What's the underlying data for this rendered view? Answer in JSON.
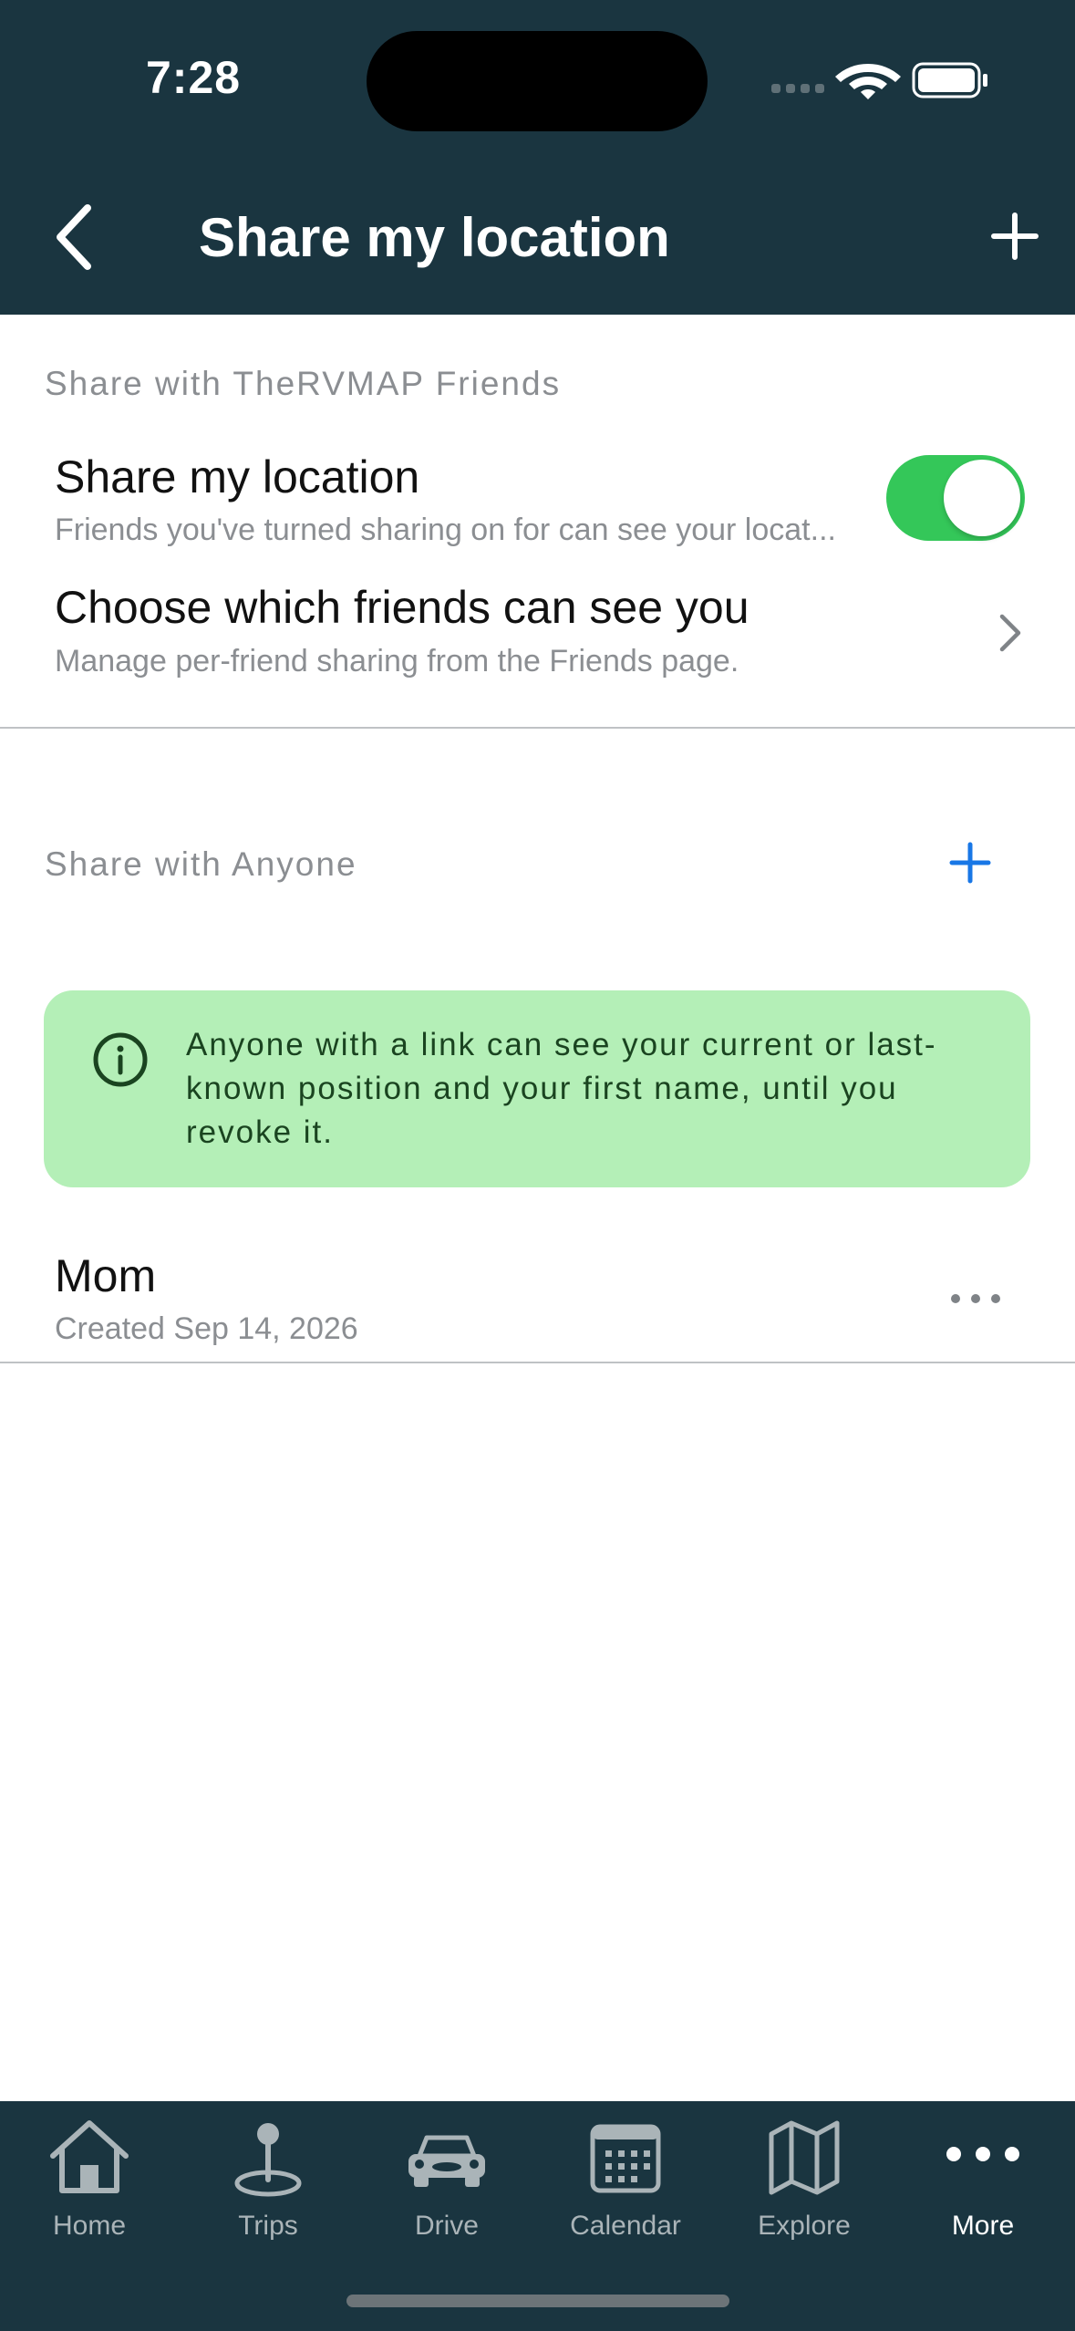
{
  "status_bar": {
    "time": "7:28"
  },
  "nav": {
    "title": "Share my location"
  },
  "friends_section": {
    "header": "Share with TheRVMAP Friends",
    "share_row": {
      "title": "Share my location",
      "subtitle": "Friends you've turned sharing on for can see your locat...",
      "toggle_on": true
    },
    "choose_row": {
      "title": "Choose which friends can see you",
      "subtitle": "Manage per-friend sharing from the Friends page."
    }
  },
  "anyone_section": {
    "header": "Share with Anyone",
    "info_text": "Anyone with a link can see your current or last-known position and your first name, until you revoke it.",
    "links": [
      {
        "name": "Mom",
        "created": "Created Sep 14, 2026"
      }
    ]
  },
  "colors": {
    "header_bg": "#1a3540",
    "toggle_on": "#34c759",
    "accent_blue": "#1877e6",
    "info_bg": "#b4efb7"
  },
  "tabs": [
    {
      "label": "Home",
      "icon": "home-icon",
      "active": false
    },
    {
      "label": "Trips",
      "icon": "map-pin-icon",
      "active": false
    },
    {
      "label": "Drive",
      "icon": "car-icon",
      "active": false
    },
    {
      "label": "Calendar",
      "icon": "calendar-icon",
      "active": false
    },
    {
      "label": "Explore",
      "icon": "map-icon",
      "active": false
    },
    {
      "label": "More",
      "icon": "more-icon",
      "active": true
    }
  ]
}
